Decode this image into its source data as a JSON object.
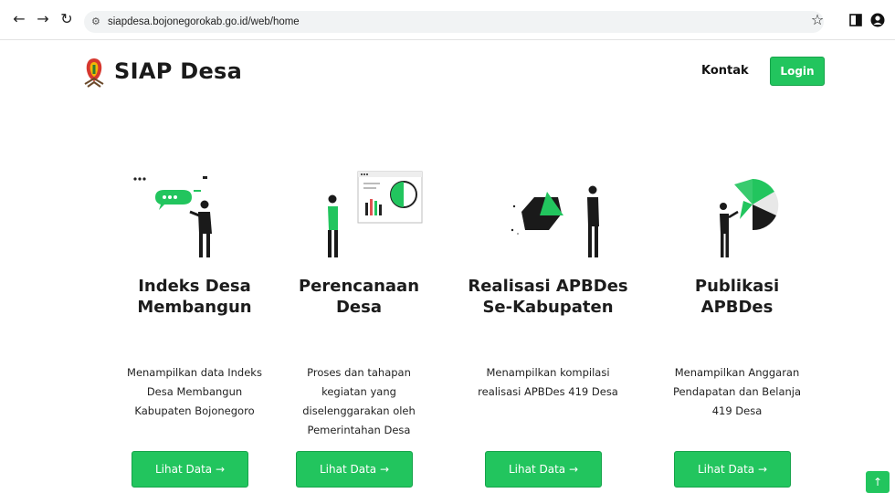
{
  "browser": {
    "url": "siapdesa.bojonegorokab.go.id/web/home",
    "back_icon": "arrow-left",
    "forward_icon": "arrow-right",
    "reload_icon": "reload",
    "bookmark_icon": "star",
    "panel_icon": "side-panel",
    "profile_icon": "profile"
  },
  "header": {
    "brand": "SIAP Desa",
    "nav_contact": "Kontak",
    "login_label": "Login",
    "accent_color": "#22c55e"
  },
  "cards": [
    {
      "title_line1": "Indeks Desa",
      "title_line2": "Membangun",
      "desc_line1": "Menampilkan data Indeks",
      "desc_line2": "Desa Membangun",
      "desc_line3": "Kabupaten Bojonegoro",
      "desc_line4": "",
      "button": "Lihat Data →"
    },
    {
      "title_line1": "Perencanaan",
      "title_line2": "Desa",
      "desc_line1": "Proses dan tahapan",
      "desc_line2": "kegiatan yang",
      "desc_line3": "diselenggarakan oleh",
      "desc_line4": "Pemerintahan Desa",
      "button": "Lihat Data →"
    },
    {
      "title_line1": "Realisasi APBDes",
      "title_line2": "Se-Kabupaten",
      "desc_line1": "Menampilkan kompilasi",
      "desc_line2": "realisasi APBDes 419 Desa",
      "desc_line3": "",
      "desc_line4": "",
      "button": "Lihat Data →"
    },
    {
      "title_line1": "Publikasi",
      "title_line2": "APBDes",
      "desc_line1": "Menampilkan Anggaran",
      "desc_line2": "Pendapatan dan Belanja",
      "desc_line3": "419 Desa",
      "desc_line4": "",
      "button": "Lihat Data →"
    }
  ],
  "back_to_top_icon": "arrow-up"
}
